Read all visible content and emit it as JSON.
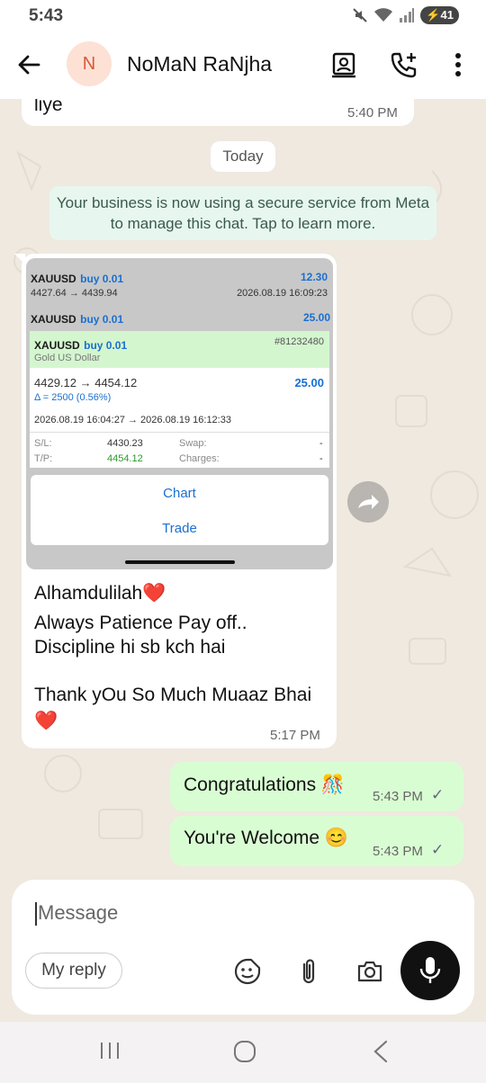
{
  "status_bar": {
    "time": "5:43",
    "battery": "41"
  },
  "header": {
    "avatar_letter": "N",
    "contact_name": "NoMaN RaNjha"
  },
  "chat": {
    "prev_message": {
      "text": "liye",
      "time": "5:40 PM"
    },
    "date_chip": "Today",
    "system_message": "Your business is now using a secure service from Meta to manage this chat. Tap to learn more.",
    "image_message": {
      "rows": [
        {
          "symbol": "XAUUSD",
          "side": "buy 0.01",
          "profit": "12.30",
          "prices": "4427.64 → 4439.94",
          "date": "2026.08.19 16:09:23"
        },
        {
          "symbol": "XAUUSD",
          "side": "buy 0.01",
          "profit": "25.00"
        }
      ],
      "detail": {
        "symbol": "XAUUSD",
        "side": "buy 0.01",
        "order_id": "#81232480",
        "description": "Gold US Dollar",
        "prices": "4429.12 → 4454.12",
        "profit": "25.00",
        "delta": "Δ = 2500 (0.56%)",
        "dates": "2026.08.19 16:04:27 → 2026.08.19 16:12:33",
        "sl_label": "S/L:",
        "sl_value": "4430.23",
        "tp_label": "T/P:",
        "tp_value": "4454.12",
        "swap_label": "Swap:",
        "swap_value": "-",
        "charges_label": "Charges:",
        "charges_value": "-"
      },
      "sheet": {
        "chart": "Chart",
        "trade": "Trade"
      }
    },
    "incoming_caption": {
      "line1": "Alhamdulilah❤️",
      "line2": "Always Patience Pay off..",
      "line3": "Discipline hi sb kch hai",
      "line4": "Thank yOu So Much Muaaz Bhai",
      "line5": "❤️",
      "time": "5:17 PM"
    },
    "outgoing": [
      {
        "text": "Congratulations 🎊",
        "time": "5:43 PM",
        "status": "✓"
      },
      {
        "text": "You're Welcome 😊",
        "time": "5:43 PM",
        "status": "✓"
      }
    ]
  },
  "composer": {
    "placeholder": "Message",
    "quick_reply": "My reply"
  },
  "colors": {
    "outgoing_bubble": "#d9fdd3",
    "system_bubble": "#e7f7ef",
    "accent_blue": "#1a6fd1",
    "wallpaper": "#efe9e0"
  },
  "icons": [
    "back-arrow-icon",
    "contacts-icon",
    "add-call-icon",
    "more-vert-icon",
    "forward-icon",
    "sticker-icon",
    "attach-icon",
    "camera-icon",
    "mic-icon",
    "double-tick-icon"
  ]
}
